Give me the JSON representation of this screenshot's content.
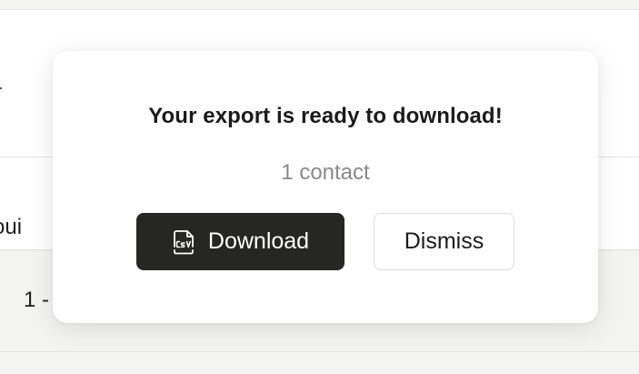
{
  "background": {
    "header_partial_text": "oui",
    "row_partial_text": "1 -"
  },
  "modal": {
    "title": "Your export is ready to download!",
    "subtitle": "1 contact",
    "download_button": {
      "label": "Download",
      "icon": "csv-file-icon"
    },
    "dismiss_button": {
      "label": "Dismiss"
    }
  },
  "colors": {
    "primary_button_bg": "#262624",
    "subtitle_text": "#8a8a8a",
    "backdrop": "#f1f1f0"
  }
}
